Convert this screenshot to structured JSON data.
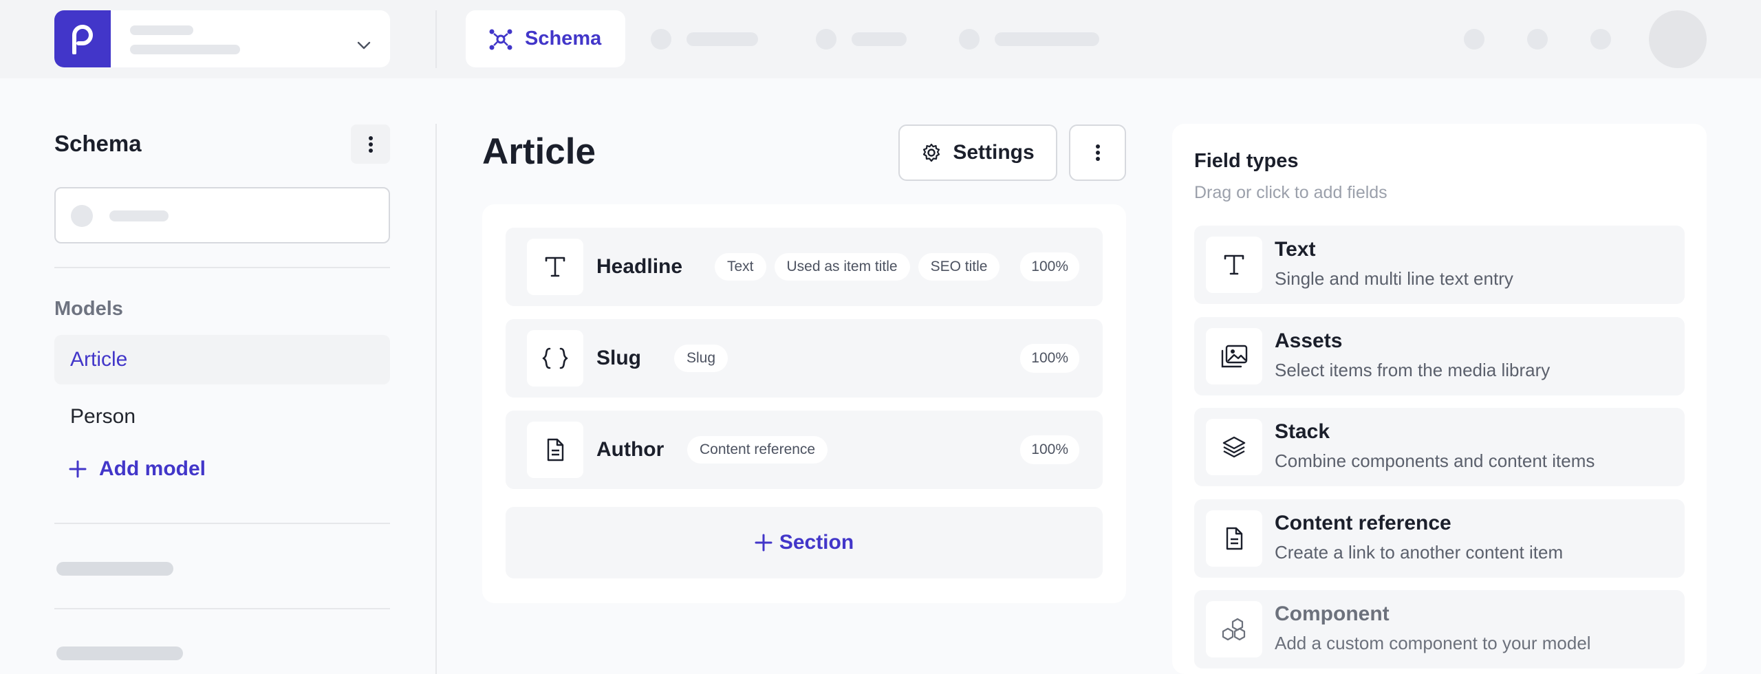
{
  "header": {
    "active_tab": "Schema"
  },
  "sidebar": {
    "title": "Schema",
    "models_label": "Models",
    "models": [
      {
        "label": "Article",
        "active": true
      },
      {
        "label": "Person",
        "active": false
      }
    ],
    "add_model_label": "Add model"
  },
  "main": {
    "title": "Article",
    "settings_label": "Settings",
    "fields": [
      {
        "name": "Headline",
        "icon": "text-icon",
        "tags": [
          "Text",
          "Used as item title",
          "SEO title"
        ],
        "percent": "100%"
      },
      {
        "name": "Slug",
        "icon": "braces-icon",
        "tags": [
          "Slug"
        ],
        "percent": "100%"
      },
      {
        "name": "Author",
        "icon": "document-icon",
        "tags": [
          "Content reference"
        ],
        "percent": "100%"
      }
    ],
    "section_label": "Section"
  },
  "field_types": {
    "title": "Field types",
    "subtitle": "Drag or click to add fields",
    "items": [
      {
        "name": "Text",
        "desc": "Single and multi line text entry",
        "icon": "text-icon"
      },
      {
        "name": "Assets",
        "desc": "Select items from the media library",
        "icon": "images-icon"
      },
      {
        "name": "Stack",
        "desc": "Combine components and content items",
        "icon": "layers-icon"
      },
      {
        "name": "Content reference",
        "desc": "Create a link to another content item",
        "icon": "document-icon"
      },
      {
        "name": "Component",
        "desc": "Add a custom component to your model",
        "icon": "cubes-icon"
      }
    ]
  },
  "colors": {
    "accent": "#4236c9",
    "background": "#f9fafc",
    "topbar": "#f3f4f6"
  }
}
